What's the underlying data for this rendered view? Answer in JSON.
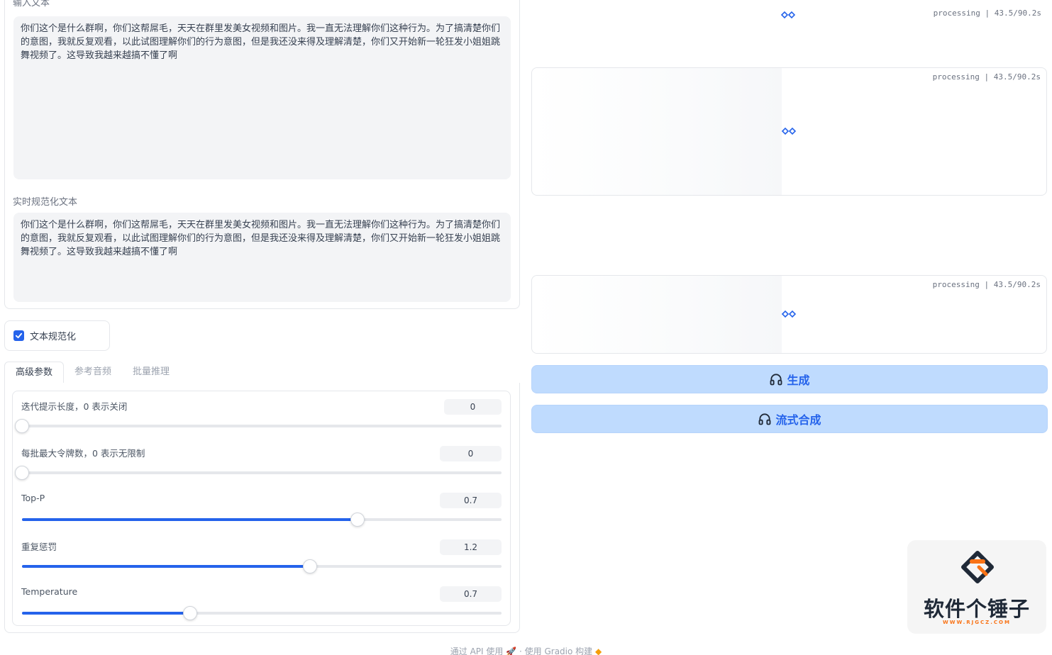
{
  "input_text": {
    "label": "输入文本",
    "value": "你们这个是什么群啊，你们这帮屌毛，天天在群里发美女视频和图片。我一直无法理解你们这种行为。为了搞清楚你们的意图，我就反复观看，以此试图理解你们的行为意图，但是我还没来得及理解清楚，你们又开始新一轮狂发小姐姐跳舞视频了。这导致我越来越搞不懂了啊"
  },
  "normalized_text": {
    "label": "实时规范化文本",
    "value": "你们这个是什么群啊，你们这帮屌毛，天天在群里发美女视频和图片。我一直无法理解你们这种行为。为了搞清楚你们的意图，我就反复观看，以此试图理解你们的行为意图，但是我还没来得及理解清楚，你们又开始新一轮狂发小姐姐跳舞视频了。这导致我越来越搞不懂了啊"
  },
  "normalize_checkbox": {
    "label": "文本规范化",
    "checked": true
  },
  "tabs": [
    {
      "label": "高级参数",
      "active": true
    },
    {
      "label": "参考音频",
      "active": false
    },
    {
      "label": "批量推理",
      "active": false
    }
  ],
  "params": [
    {
      "label": "迭代提示长度，0 表示关闭",
      "value": "0",
      "fraction": 0.0
    },
    {
      "label": "每批最大令牌数，0 表示无限制",
      "value": "0",
      "fraction": 0.0
    },
    {
      "label": "Top-P",
      "value": "0.7",
      "fraction": 0.7
    },
    {
      "label": "重复惩罚",
      "value": "1.2",
      "fraction": 0.6
    },
    {
      "label": "Temperature",
      "value": "0.7",
      "fraction": 0.35
    }
  ],
  "audio_outputs": [
    {
      "status": "processing | 43.5/90.2s"
    },
    {
      "status": "processing | 43.5/90.2s"
    },
    {
      "status": "processing | 43.5/90.2s"
    }
  ],
  "buttons": {
    "generate": "生成",
    "stream": "流式合成"
  },
  "footer": {
    "api": "通过 API 使用",
    "sep": "·",
    "built": "使用 Gradio 构建"
  },
  "watermark": {
    "name": "软件个锤子",
    "url": "WWW.RJGCZ.COM"
  },
  "colors": {
    "accent": "#2563eb",
    "button_bg": "#bfdbfe",
    "textbox_bg": "#f3f4f6",
    "watermark_orange": "#f97316"
  }
}
